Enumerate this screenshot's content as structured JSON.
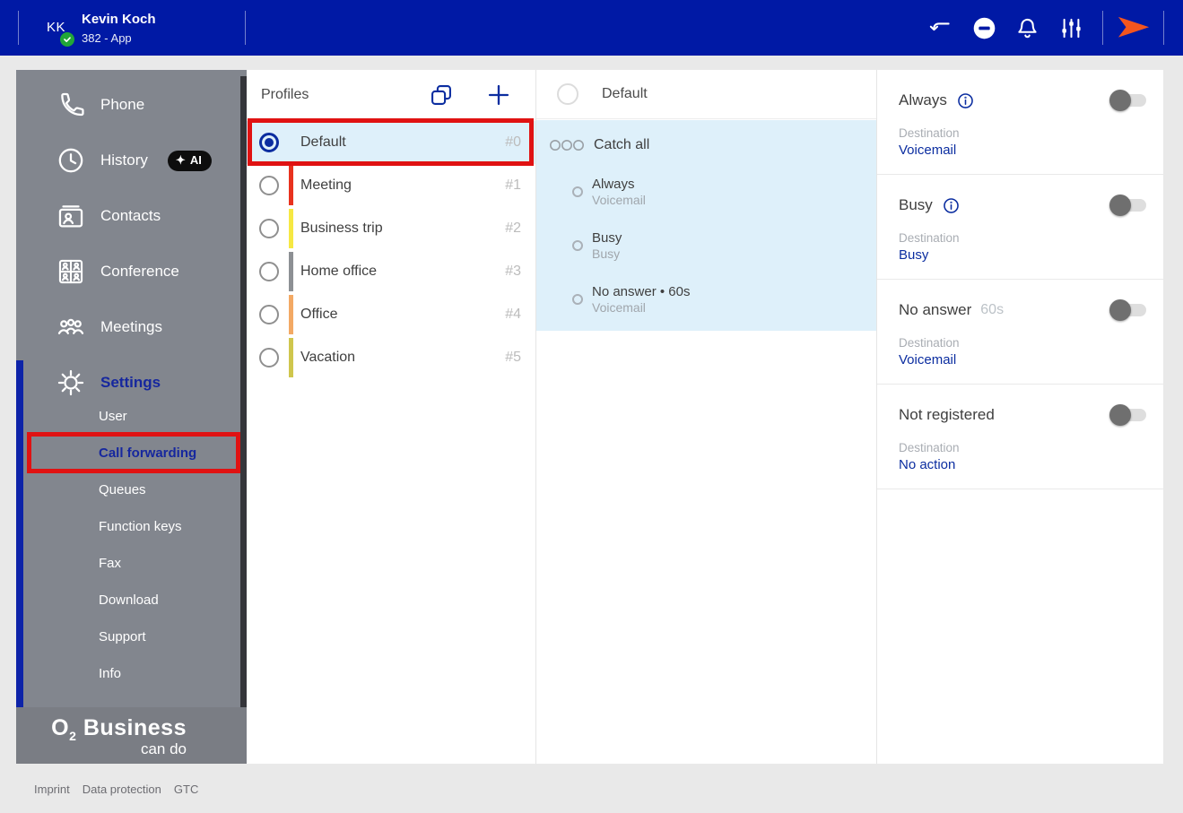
{
  "topbar": {
    "initials": "KK",
    "name": "Kevin Koch",
    "subtitle": "382 - App"
  },
  "sidebar": {
    "items": [
      {
        "label": "Phone"
      },
      {
        "label": "History",
        "badge_star": "✦",
        "badge": "AI"
      },
      {
        "label": "Contacts"
      },
      {
        "label": "Conference"
      },
      {
        "label": "Meetings"
      },
      {
        "label": "Settings",
        "active": true
      }
    ],
    "settings_children": [
      {
        "label": "User"
      },
      {
        "label": "Call forwarding",
        "active": true
      },
      {
        "label": "Queues"
      },
      {
        "label": "Function keys"
      },
      {
        "label": "Fax"
      },
      {
        "label": "Download"
      },
      {
        "label": "Support"
      },
      {
        "label": "Info"
      }
    ],
    "logo": {
      "o": "O",
      "sub": "2",
      "word": "Business",
      "tagline": "can do"
    }
  },
  "profiles": {
    "title": "Profiles",
    "items": [
      {
        "label": "Default",
        "number": "#0",
        "selected": true,
        "color": null
      },
      {
        "label": "Meeting",
        "number": "#1",
        "selected": false,
        "color": "#e8321e"
      },
      {
        "label": "Business trip",
        "number": "#2",
        "selected": false,
        "color": "#f6e843"
      },
      {
        "label": "Home office",
        "number": "#3",
        "selected": false,
        "color": "#8d9094"
      },
      {
        "label": "Office",
        "number": "#4",
        "selected": false,
        "color": "#f3a964"
      },
      {
        "label": "Vacation",
        "number": "#5",
        "selected": false,
        "color": "#cfc64d"
      }
    ]
  },
  "rules": {
    "header": "Default",
    "group": "Catch all",
    "items": [
      {
        "title": "Always",
        "destination": "Voicemail"
      },
      {
        "title": "Busy",
        "destination": "Busy"
      },
      {
        "title": "No answer • 60s",
        "destination": "Voicemail"
      }
    ]
  },
  "details": {
    "sections": [
      {
        "title": "Always",
        "info": true,
        "suffix": "",
        "dest_label": "Destination",
        "dest_value": "Voicemail",
        "enabled": false
      },
      {
        "title": "Busy",
        "info": true,
        "suffix": "",
        "dest_label": "Destination",
        "dest_value": "Busy",
        "enabled": false
      },
      {
        "title": "No answer",
        "info": false,
        "suffix": "60s",
        "dest_label": "Destination",
        "dest_value": "Voicemail",
        "enabled": false
      },
      {
        "title": "Not registered",
        "info": false,
        "suffix": "",
        "dest_label": "Destination",
        "dest_value": "No action",
        "enabled": false
      }
    ]
  },
  "footer": {
    "links": [
      {
        "label": "Imprint"
      },
      {
        "label": "Data protection"
      },
      {
        "label": "GTC"
      }
    ]
  },
  "colors": {
    "topbar_blue": "#0019a5",
    "accent_blue": "#0b2da0",
    "selection_blue": "#def0fa",
    "sidebar_gray": "#82868e",
    "annotation_red": "#e01212",
    "logo_orange": "#f4551e",
    "presence_green": "#21a637"
  }
}
